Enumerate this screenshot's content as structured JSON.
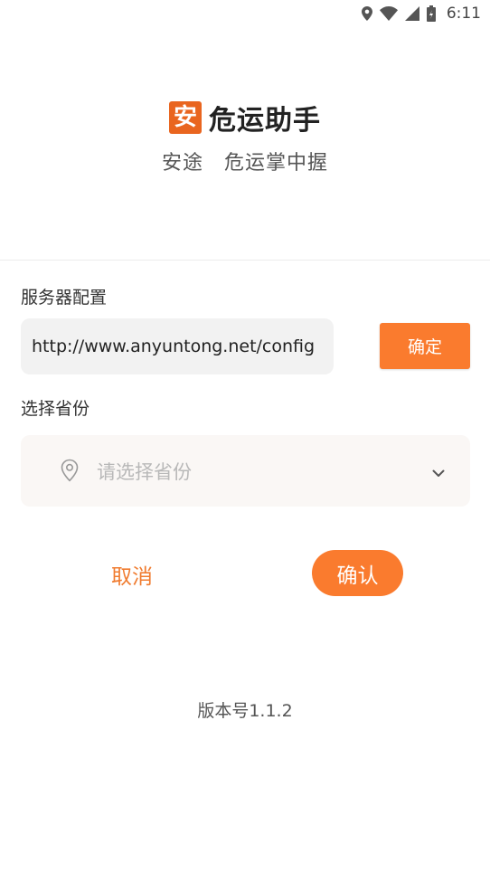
{
  "status_bar": {
    "time": "6:11"
  },
  "brand": {
    "logo_char": "安",
    "title": "危运助手",
    "slogan": "安途　危运掌中握"
  },
  "server_config": {
    "label": "服务器配置",
    "url_value": "http://www.anyuntong.net/config",
    "confirm_label": "确定"
  },
  "province": {
    "label": "选择省份",
    "placeholder": "请选择省份"
  },
  "actions": {
    "cancel_label": "取消",
    "confirm_label": "确认"
  },
  "footer": {
    "version": "版本号1.1.2"
  },
  "colors": {
    "accent": "#fa7b2e",
    "accent_text": "#f07c30",
    "logo_bg": "#e9651f"
  }
}
